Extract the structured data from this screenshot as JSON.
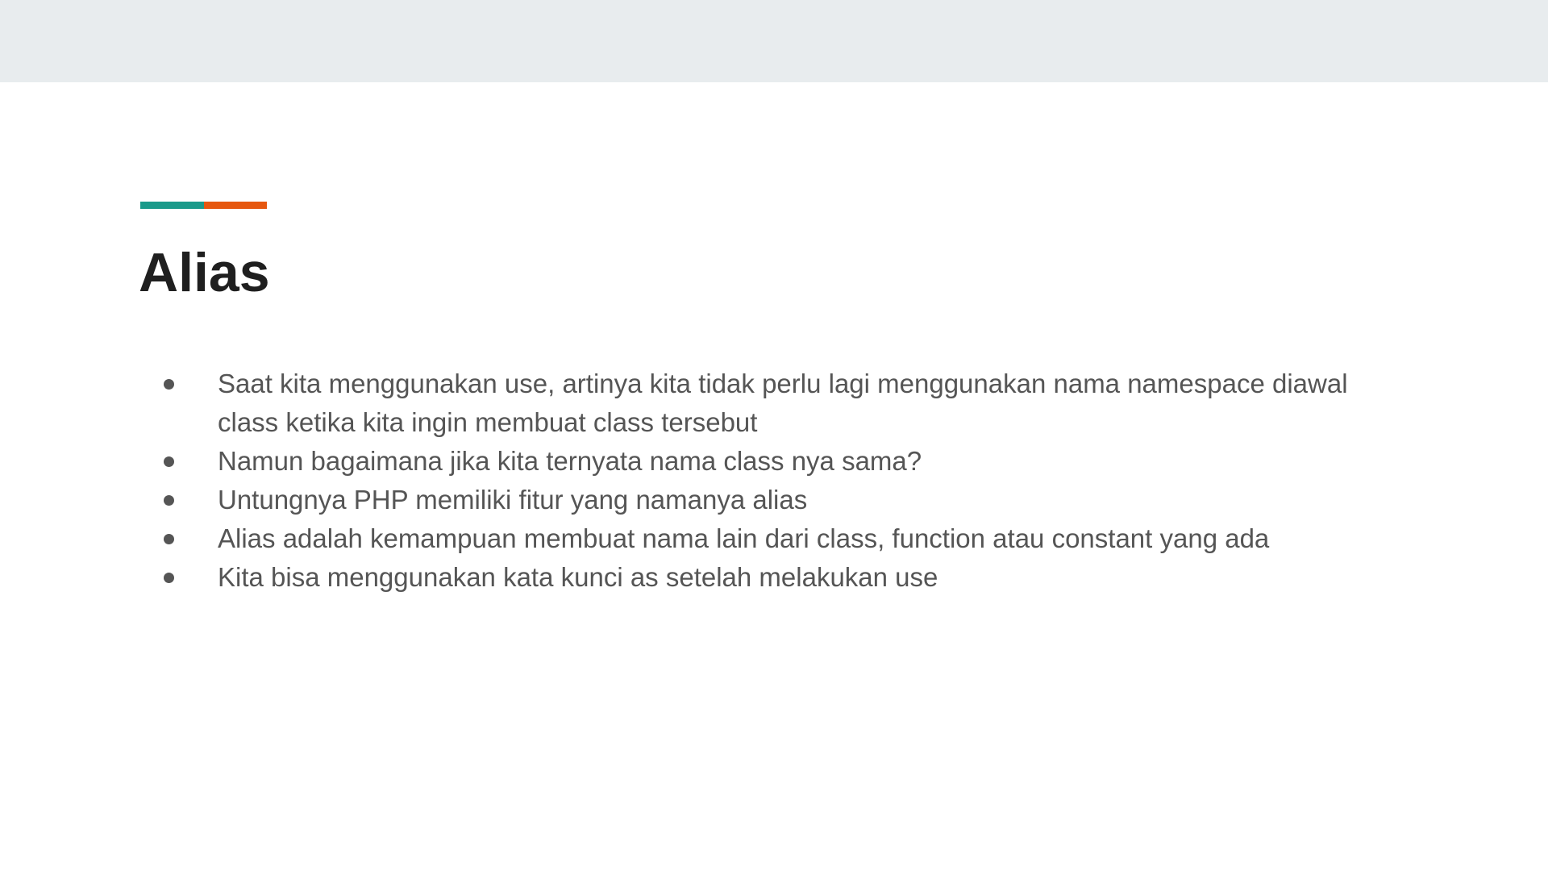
{
  "slide": {
    "title": "Alias",
    "accent_colors": [
      "#1a9a8a",
      "#e6570f"
    ],
    "bullets": [
      {
        "text": "Saat kita menggunakan use, artinya kita tidak perlu lagi menggunakan nama namespace diawal class ketika kita ingin membuat class tersebut"
      },
      {
        "text": "Namun bagaimana jika kita ternyata nama class nya sama?"
      },
      {
        "text": "Untungnya PHP memiliki fitur yang namanya alias"
      },
      {
        "text": "Alias adalah kemampuan membuat nama lain dari class, function atau constant yang ada"
      },
      {
        "text": "Kita bisa menggunakan kata kunci as setelah melakukan use"
      }
    ]
  }
}
